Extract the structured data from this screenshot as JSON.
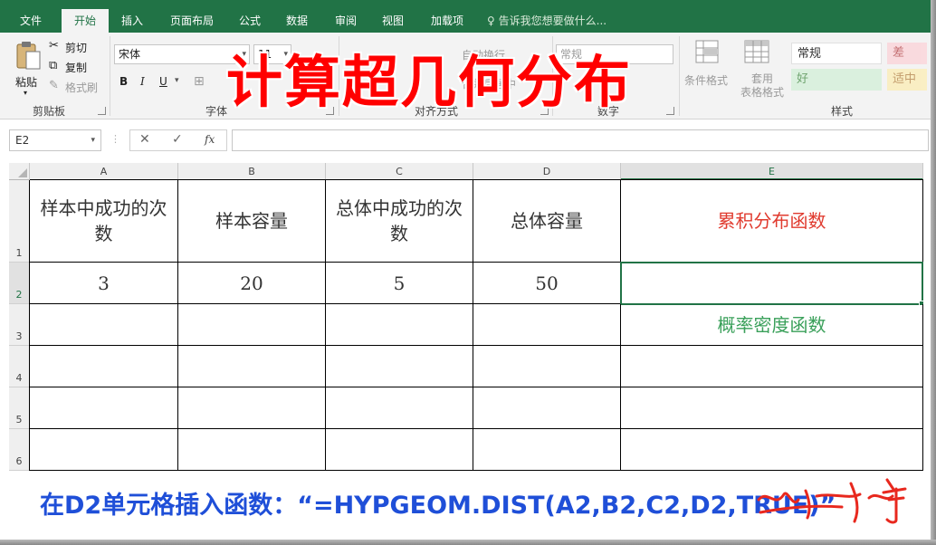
{
  "tabs": [
    "文件",
    "开始",
    "插入",
    "页面布局",
    "公式",
    "数据",
    "审阅",
    "视图",
    "加载项"
  ],
  "active_tab": "开始",
  "tell_me": "告诉我您想要做什么...",
  "ribbon": {
    "clipboard": {
      "paste": "粘贴",
      "cut": "剪切",
      "copy": "复制",
      "format_painter": "格式刷",
      "label": "剪贴板"
    },
    "font": {
      "name": "宋体",
      "size": "11",
      "bold": "B",
      "italic": "I",
      "underline": "U",
      "label": "字体"
    },
    "alignment": {
      "wrap": "自动换行",
      "merge": "合并后居中",
      "label": "对齐方式"
    },
    "number": {
      "format": "常规",
      "label": "数字"
    },
    "styles": {
      "conditional": "条件格式",
      "table_format": "套用\n表格格式",
      "normal": "常规",
      "bad": "差",
      "good": "好",
      "neutral": "适中",
      "label": "样式"
    }
  },
  "formula_bar": {
    "name_box": "E2",
    "cancel": "✕",
    "confirm": "✓",
    "fx": "fx",
    "value": ""
  },
  "columns": [
    "A",
    "B",
    "C",
    "D",
    "E"
  ],
  "selected_column": "E",
  "rows": [
    "1",
    "2",
    "3",
    "4",
    "5",
    "6"
  ],
  "selected_row": "2",
  "cells": {
    "A1": "样本中成功的次数",
    "B1": "样本容量",
    "C1": "总体中成功的次数",
    "D1": "总体容量",
    "E1": "累积分布函数",
    "A2": "3",
    "B2": "20",
    "C2": "5",
    "D2": "50",
    "E2": "",
    "E3": "概率密度函数"
  },
  "colors": {
    "excel_green": "#217346",
    "title_red": "#ff0000",
    "cdf_red": "#e03a2e",
    "pdf_green": "#3aa05a",
    "caption_blue": "#1f4fd8"
  },
  "overlay": {
    "title": "计算超几何分布",
    "caption": "在D2单元格插入函数：“=HYPGEOM.DIST(A2,B2,C2,D2,TRUE)”"
  }
}
